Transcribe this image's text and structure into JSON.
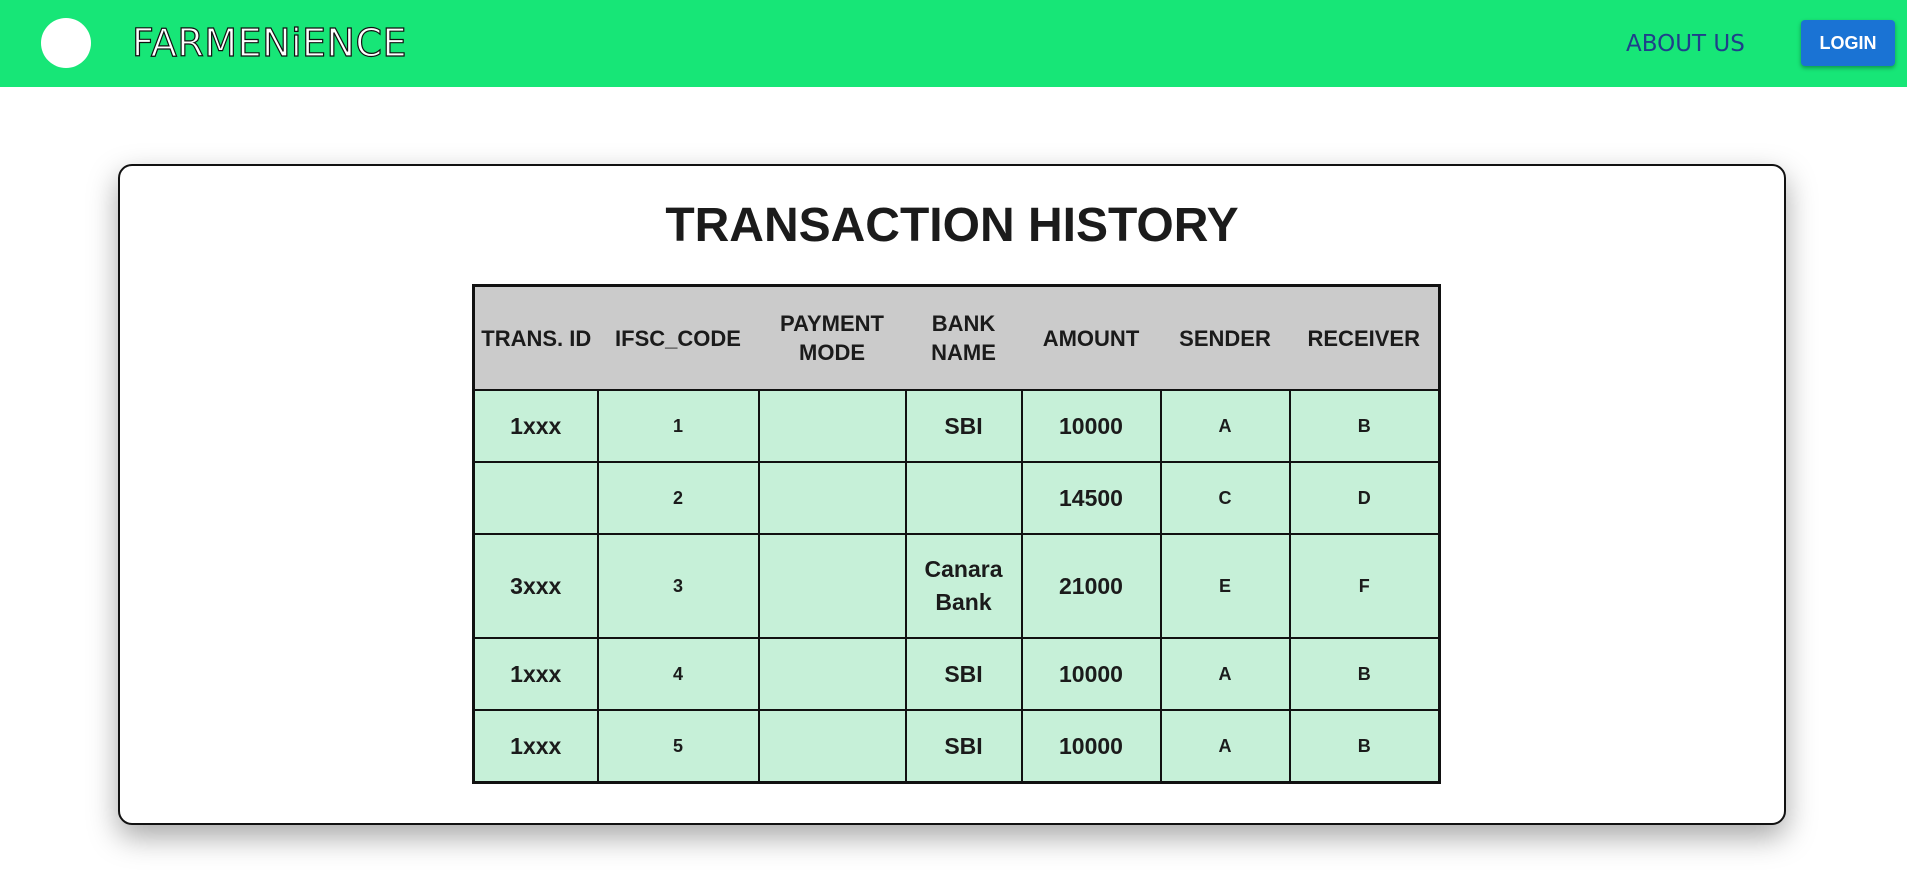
{
  "nav": {
    "brand": "FARMENiENCE",
    "about_label": "ABOUT US",
    "login_label": "LOGIN",
    "bar_color": "#17e677",
    "login_color": "#1a73d4"
  },
  "page": {
    "title": "TRANSACTION HISTORY"
  },
  "table": {
    "headers": [
      "TRANS. ID",
      "IFSC_CODE",
      "PAYMENT MODE",
      "BANK NAME",
      "AMOUNT",
      "SENDER",
      "RECEIVER"
    ],
    "rows": [
      [
        "1xxx",
        "1",
        "",
        "SBI",
        "10000",
        "A",
        "B"
      ],
      [
        "",
        "2",
        "",
        "",
        "14500",
        "C",
        "D"
      ],
      [
        "3xxx",
        "3",
        "",
        "Canara Bank",
        "21000",
        "E",
        "F"
      ],
      [
        "1xxx",
        "4",
        "",
        "SBI",
        "10000",
        "A",
        "B"
      ],
      [
        "1xxx",
        "5",
        "",
        "SBI",
        "10000",
        "A",
        "B"
      ]
    ],
    "header_color": "#cbcbcb",
    "cell_color": "#c6f0d8"
  }
}
